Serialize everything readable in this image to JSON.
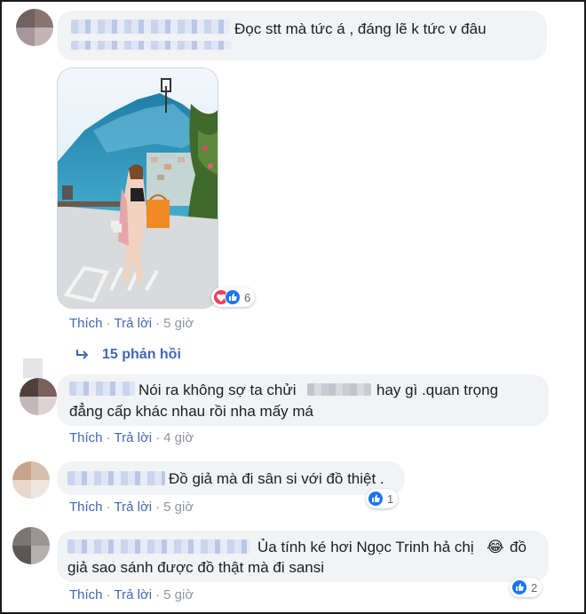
{
  "comments": [
    {
      "text": "Đọc stt mà tức á , đáng lẽ k tức v đâu",
      "actions": {
        "like": "Thích",
        "reply": "Trả lời",
        "time": "5 giờ"
      },
      "reaction_count": "6",
      "reaction_types": [
        "love",
        "like"
      ],
      "replies_label": "15 phản hồi"
    },
    {
      "text_line1_a": "Nói ra không sợ ta chửi",
      "text_line1_b": "hay gì .quan trọng",
      "text_line2": "đẳng cấp khác nhau rồi nha mấy má",
      "actions": {
        "like": "Thích",
        "reply": "Trả lời",
        "time": "4 giờ"
      }
    },
    {
      "text": "Đồ giả mà đi sân si với đồ thiệt .",
      "actions": {
        "like": "Thích",
        "reply": "Trả lời",
        "time": "5 giờ"
      },
      "reaction_count": "1",
      "reaction_types": [
        "like"
      ]
    },
    {
      "text_line1": "Ủa tính ké hơi Ngọc Trinh hả chị",
      "emoji": "😂",
      "text_line1_end": "đồ",
      "text_line2": "giả sao sánh được đồ thật mà đi sansi",
      "actions": {
        "like": "Thích",
        "reply": "Trả lời",
        "time": "5 giờ"
      },
      "reaction_count": "2",
      "reaction_types": [
        "like"
      ]
    }
  ],
  "colors": {
    "link": "#4267b2",
    "meta": "#90949c",
    "bubble": "#f2f3f5",
    "love": "#f33e58",
    "like": "#1877f2"
  }
}
